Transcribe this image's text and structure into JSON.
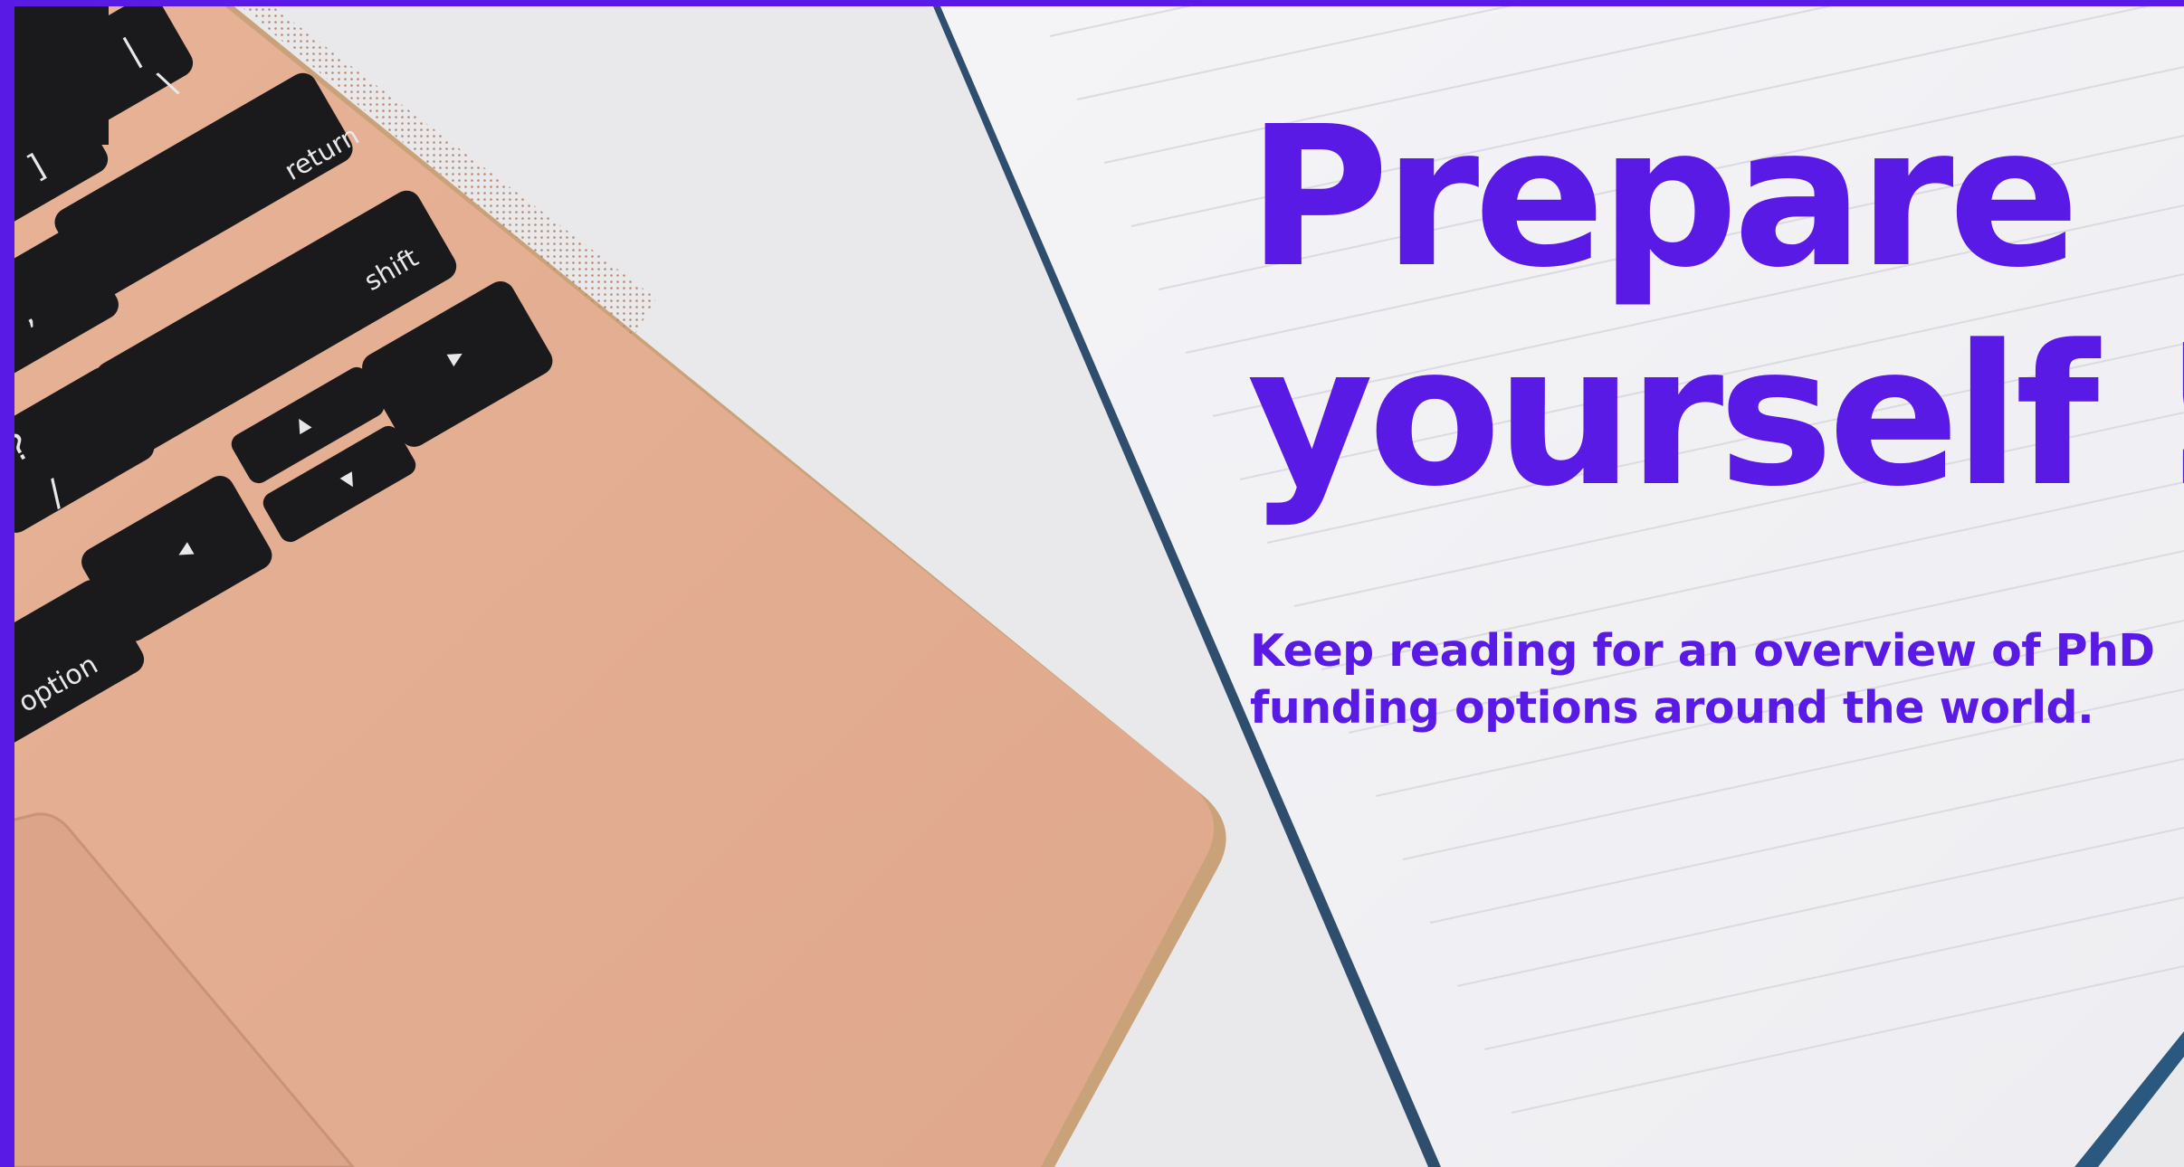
{
  "theme": {
    "accent": "#5a1ae6",
    "laptop_body": "#e3ad90",
    "notebook_page": "#f1f1f5",
    "desk": "#e9e8ea",
    "key": "#1a1a1c",
    "key_label": "#e8e8e8"
  },
  "headline": {
    "line1": "Prepare",
    "line2": "yourself !"
  },
  "subtitle": {
    "line1": "Keep reading for an overview of PhD",
    "line2": "funding options around the world."
  },
  "keyboard": {
    "return_label": "return",
    "shift_label": "shift",
    "option_label": "option",
    "question_label": "?",
    "slash_label": "/",
    "backslash_label": "\\",
    "pipe_label": "|",
    "bracket_label": "]",
    "comma_label": ",",
    "arrow_up": "▲",
    "arrow_down": "▼",
    "arrow_left": "◀",
    "arrow_right": "▶"
  }
}
